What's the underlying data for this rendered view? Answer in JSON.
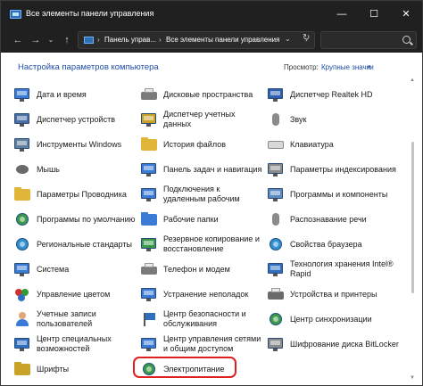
{
  "window": {
    "title": "Все элементы панели управления",
    "controls": {
      "minimize": "—",
      "maximize": "☐",
      "close": "✕"
    }
  },
  "nav": {
    "back": "←",
    "forward": "→",
    "recent": "⌄",
    "up": "↑",
    "breadcrumbs": [
      "Панель управ...",
      "Все элементы панели управления"
    ],
    "separator": "›",
    "dropdown": "⌄",
    "refresh": "↻",
    "search_placeholder": ""
  },
  "content": {
    "heading": "Настройка параметров компьютера",
    "view_label": "Просмотр:",
    "view_value": "Крупные значки",
    "view_arrow": "▾"
  },
  "scroll": {
    "up": "▲",
    "down": "▼"
  },
  "items": [
    {
      "col": 0,
      "row": 0,
      "label": "Дата и время",
      "icon": "calendar-clock-icon",
      "color": "#3a7bd5"
    },
    {
      "col": 1,
      "row": 0,
      "label": "Дисковые пространства",
      "icon": "storage-spaces-icon",
      "color": "#7a7a7a"
    },
    {
      "col": 2,
      "row": 0,
      "label": "Диспетчер Realtek HD",
      "icon": "realtek-audio-icon",
      "color": "#2f5fb0"
    },
    {
      "col": 0,
      "row": 1,
      "label": "Диспетчер устройств",
      "icon": "device-manager-icon",
      "color": "#4a6fa5"
    },
    {
      "col": 1,
      "row": 1,
      "label": "Диспетчер учетных данных",
      "icon": "credential-manager-icon",
      "color": "#c9a227"
    },
    {
      "col": 2,
      "row": 1,
      "label": "Звук",
      "icon": "speaker-icon",
      "color": "#8a8a8a"
    },
    {
      "col": 0,
      "row": 2,
      "label": "Инструменты Windows",
      "icon": "windows-tools-icon",
      "color": "#5f7f9f"
    },
    {
      "col": 1,
      "row": 2,
      "label": "История файлов",
      "icon": "file-history-icon",
      "color": "#e0b53a"
    },
    {
      "col": 2,
      "row": 2,
      "label": "Клавиатура",
      "icon": "keyboard-icon",
      "color": "#8a8a8a"
    },
    {
      "col": 0,
      "row": 3,
      "label": "Мышь",
      "icon": "mouse-icon",
      "color": "#6a6a6a"
    },
    {
      "col": 1,
      "row": 3,
      "label": "Панель задач и навигация",
      "icon": "taskbar-icon",
      "color": "#3a7bd5"
    },
    {
      "col": 2,
      "row": 3,
      "label": "Параметры индексирования",
      "icon": "indexing-options-icon",
      "color": "#8a8a8a"
    },
    {
      "col": 0,
      "row": 4,
      "label": "Параметры Проводника",
      "icon": "explorer-options-icon",
      "color": "#e0b53a"
    },
    {
      "col": 1,
      "row": 4,
      "label": "Подключения к удаленным рабочим",
      "icon": "remote-desktop-icon",
      "color": "#3a7bd5"
    },
    {
      "col": 2,
      "row": 4,
      "label": "Программы и компоненты",
      "icon": "programs-features-icon",
      "color": "#5a8ac0"
    },
    {
      "col": 0,
      "row": 5,
      "label": "Программы по умолчанию",
      "icon": "default-programs-icon",
      "color": "#3a9a4a"
    },
    {
      "col": 1,
      "row": 5,
      "label": "Рабочие папки",
      "icon": "work-folders-icon",
      "color": "#3a7bd5"
    },
    {
      "col": 2,
      "row": 5,
      "label": "Распознавание речи",
      "icon": "microphone-icon",
      "color": "#8a8a8a"
    },
    {
      "col": 0,
      "row": 6,
      "label": "Региональные стандарты",
      "icon": "region-globe-icon",
      "color": "#2f8fd0"
    },
    {
      "col": 1,
      "row": 6,
      "label": "Резервное копирование и восстановление",
      "icon": "backup-restore-icon",
      "color": "#3a9a4a"
    },
    {
      "col": 2,
      "row": 6,
      "label": "Свойства браузера",
      "icon": "internet-options-icon",
      "color": "#2f8fd0"
    },
    {
      "col": 0,
      "row": 7,
      "label": "Система",
      "icon": "system-icon",
      "color": "#3a7bd5"
    },
    {
      "col": 1,
      "row": 7,
      "label": "Телефон и модем",
      "icon": "phone-modem-icon",
      "color": "#7a7a7a"
    },
    {
      "col": 2,
      "row": 7,
      "label": "Технология хранения Intel® Rapid",
      "icon": "intel-rst-icon",
      "color": "#2f6fc0"
    },
    {
      "col": 0,
      "row": 8,
      "label": "Управление цветом",
      "icon": "color-management-icon",
      "color": "#d05a2a"
    },
    {
      "col": 1,
      "row": 8,
      "label": "Устранение неполадок",
      "icon": "troubleshooting-icon",
      "color": "#3a7bd5"
    },
    {
      "col": 2,
      "row": 8,
      "label": "Устройства и принтеры",
      "icon": "printer-icon",
      "color": "#6a6a6a"
    },
    {
      "col": 0,
      "row": 9,
      "label": "Учетные записи пользователей",
      "icon": "user-accounts-icon",
      "color": "#3a7bd5"
    },
    {
      "col": 1,
      "row": 9,
      "label": "Центр безопасности и обслуживания",
      "icon": "security-flag-icon",
      "color": "#2f6fc0"
    },
    {
      "col": 2,
      "row": 9,
      "label": "Центр синхронизации",
      "icon": "sync-center-icon",
      "color": "#3a9a4a"
    },
    {
      "col": 0,
      "row": 10,
      "label": "Центр специальных возможностей",
      "icon": "accessibility-icon",
      "color": "#2f6fc0"
    },
    {
      "col": 1,
      "row": 10,
      "label": "Центр управления сетями и общим доступом",
      "icon": "network-center-icon",
      "color": "#3a7bd5"
    },
    {
      "col": 2,
      "row": 10,
      "label": "Шифрование диска BitLocker",
      "icon": "bitlocker-icon",
      "color": "#8a8a8a"
    },
    {
      "col": 0,
      "row": 11,
      "label": "Шрифты",
      "icon": "fonts-icon",
      "color": "#c9a227"
    },
    {
      "col": 1,
      "row": 11,
      "label": "Электропитание",
      "icon": "power-options-icon",
      "color": "#3a9a4a"
    }
  ]
}
